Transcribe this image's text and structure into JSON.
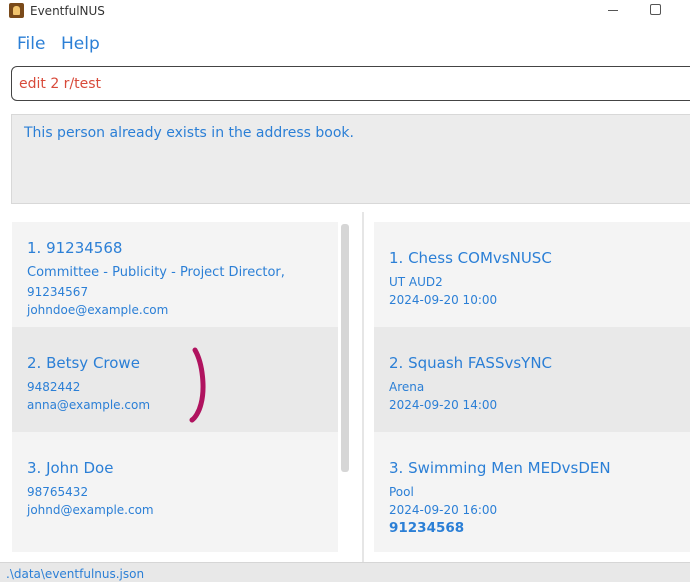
{
  "window": {
    "title": "EventfulNUS",
    "app_icon": "app-logo-icon",
    "minimize_icon": "minimize-icon",
    "maximize_icon": "maximize-icon"
  },
  "menu": {
    "file": "File",
    "help": "Help"
  },
  "command": {
    "value": "edit 2 r/test"
  },
  "result": {
    "message": "This person already exists in the address book."
  },
  "persons": [
    {
      "title": "1. 91234568",
      "role": "Committee - Publicity - Project Director,",
      "phone": "91234567",
      "email": "johndoe@example.com"
    },
    {
      "title": "2. Betsy Crowe",
      "phone": "9482442",
      "email": "anna@example.com"
    },
    {
      "title": "3. John Doe",
      "phone": "98765432",
      "email": "johnd@example.com"
    }
  ],
  "events": [
    {
      "title": "1. Chess COMvsNUSC",
      "venue": "UT AUD2",
      "datetime": "2024-09-20 10:00"
    },
    {
      "title": "2. Squash FASSvsYNC",
      "venue": "Arena",
      "datetime": "2024-09-20 14:00"
    },
    {
      "title": "3. Swimming Men MEDvsDEN",
      "venue": "Pool",
      "datetime": "2024-09-20 16:00",
      "extra": "91234568"
    }
  ],
  "status": {
    "path": ".\\data\\eventfulnus.json"
  },
  "colors": {
    "accent": "#2b7fd6",
    "error_text": "#d84a3a",
    "annotation_stroke": "#b0135f"
  }
}
